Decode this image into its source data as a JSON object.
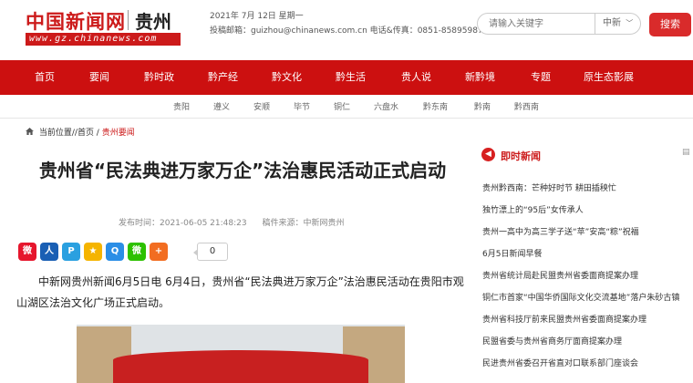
{
  "header": {
    "logo_main": "中国新闻网",
    "logo_region": "贵州",
    "logo_url": "www.gz.chinanews.com",
    "date_line": "2021年 7月 12日   星期一",
    "contact_line": "投稿邮箱：guizhou@chinanews.com.cn 电话&传真：0851-85895987"
  },
  "search": {
    "placeholder": "请输入关键字",
    "scope": "中新",
    "button": "搜索"
  },
  "nav": [
    "首页",
    "要闻",
    "黔时政",
    "黔产经",
    "黔文化",
    "黔生活",
    "贵人说",
    "新黔境",
    "专题",
    "原生态影展"
  ],
  "subnav": [
    "贵阳",
    "遵义",
    "安顺",
    "毕节",
    "铜仁",
    "六盘水",
    "黔东南",
    "黔南",
    "黔西南"
  ],
  "breadcrumb": {
    "prefix": "当前位置//首页 / ",
    "current": "贵州要闻"
  },
  "article": {
    "title": "贵州省“民法典进万家万企”法治惠民活动正式启动",
    "published": "发布时间：2021-06-05 21:48:23",
    "source": "稿件来源：中新网贵州",
    "share_count": "0",
    "body": "中新网贵州新闻6月5日电 6月4日，贵州省“民法典进万家万企”法治惠民活动在贵阳市观山湖区法治文化广场正式启动。"
  },
  "share_icons": [
    {
      "name": "weibo-icon",
      "glyph": "微",
      "color": "#e6162d"
    },
    {
      "name": "people-icon",
      "glyph": "人",
      "color": "#1a5fb4"
    },
    {
      "name": "p-icon",
      "glyph": "P",
      "color": "#2aa0e0"
    },
    {
      "name": "qzone-icon",
      "glyph": "★",
      "color": "#f5b400"
    },
    {
      "name": "qq-icon",
      "glyph": "Q",
      "color": "#2b8ee6"
    },
    {
      "name": "wechat-icon",
      "glyph": "微",
      "color": "#2dc100"
    },
    {
      "name": "more-share-icon",
      "glyph": "+",
      "color": "#f26d21"
    }
  ],
  "sidebar": {
    "title": "即时新闻",
    "items": [
      "贵州黔西南：芒种好时节 耕田插秧忙",
      "独竹漂上的“95后”女传承人",
      "贵州一高中为高三学子送“苹”安高“粽”祝福",
      "6月5日新闻早餐",
      "贵州省统计局赴民盟贵州省委面商提案办理",
      "铜仁市首家“中国华侨国际文化交流基地”落户朱砂古镇",
      "贵州省科技厅前来民盟贵州省委面商提案办理",
      "民盟省委与贵州省商务厅面商提案办理",
      "民进贵州省委召开省直对口联系部门座谈会"
    ]
  }
}
